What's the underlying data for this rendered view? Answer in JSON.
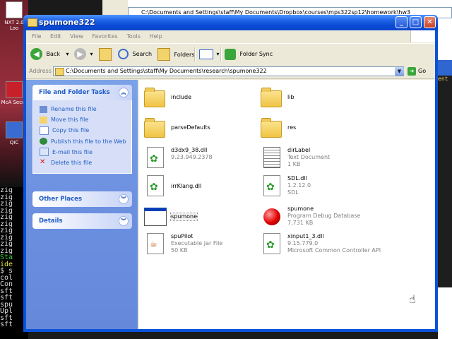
{
  "desktop": {
    "icons": [
      {
        "label": "NXT 2.0 Loo"
      },
      {
        "label": "McA Secur"
      },
      {
        "label": "QIC"
      }
    ],
    "terminal_lines": [
      {
        "text": "zig",
        "color": "plain"
      },
      {
        "text": "zig",
        "color": "plain"
      },
      {
        "text": "zig",
        "color": "plain"
      },
      {
        "text": "zig",
        "color": "plain"
      },
      {
        "text": "zig",
        "color": "plain"
      },
      {
        "text": "zig",
        "color": "plain"
      },
      {
        "text": "zig",
        "color": "plain"
      },
      {
        "text": "zig",
        "color": "plain"
      },
      {
        "text": "zig",
        "color": "plain"
      },
      {
        "text": "zig",
        "color": "plain"
      },
      {
        "text": "Sta",
        "color": "green"
      },
      {
        "text": "ide",
        "color": "yellow"
      },
      {
        "text": "$ s",
        "color": "plain"
      },
      {
        "text": "col",
        "color": "plain"
      },
      {
        "text": "Con",
        "color": "plain"
      },
      {
        "text": "sft",
        "color": "plain"
      },
      {
        "text": "sft",
        "color": "plain"
      },
      {
        "text": "spu",
        "color": "plain"
      },
      {
        "text": "Upl",
        "color": "plain"
      },
      {
        "text": "sft",
        "color": "plain"
      },
      {
        "text": "sft",
        "color": "plain"
      }
    ],
    "background_address": "C:\\Documents and Settings\\staff\\My Documents\\Dropbox\\courses\\mps322sp12\\homework\\hw3",
    "right_terminal_text": "ent"
  },
  "window": {
    "title": "spumone322",
    "buttons": {
      "minimize": "_",
      "maximize": "□",
      "close": "✕"
    }
  },
  "menu": [
    "File",
    "Edit",
    "View",
    "Favorites",
    "Tools",
    "Help"
  ],
  "toolbar": {
    "back": "Back",
    "search": "Search",
    "folders": "Folders",
    "folder_sync": "Folder Sync"
  },
  "addressbar": {
    "label": "Address",
    "value": "C:\\Documents and Settings\\staff\\My Documents\\research\\spumone322",
    "go": "Go"
  },
  "left_pane": {
    "tasks_header": "File and Folder Tasks",
    "tasks": [
      {
        "label": "Rename this file",
        "icon": "rename-icon"
      },
      {
        "label": "Move this file",
        "icon": "move-icon"
      },
      {
        "label": "Copy this file",
        "icon": "copy-icon"
      },
      {
        "label": "Publish this file to the Web",
        "icon": "globe-icon"
      },
      {
        "label": "E-mail this file",
        "icon": "email-icon"
      },
      {
        "label": "Delete this file",
        "icon": "delete-icon"
      }
    ],
    "other_places": "Other Places",
    "details": "Details"
  },
  "files": [
    {
      "name": "include",
      "line2": "",
      "line3": "",
      "kind": "folder"
    },
    {
      "name": "lib",
      "line2": "",
      "line3": "",
      "kind": "folder"
    },
    {
      "name": "parseDefaults",
      "line2": "",
      "line3": "",
      "kind": "folder"
    },
    {
      "name": "res",
      "line2": "",
      "line3": "",
      "kind": "folder"
    },
    {
      "name": "d3dx9_38.dll",
      "line2": "9.23.949.2378",
      "line3": "",
      "kind": "dll"
    },
    {
      "name": "dirLabel",
      "line2": "Text Document",
      "line3": "1 KB",
      "kind": "doc"
    },
    {
      "name": "irrKlang.dll",
      "line2": "",
      "line3": "",
      "kind": "dll"
    },
    {
      "name": "SDL.dll",
      "line2": "1.2.12.0",
      "line3": "SDL",
      "kind": "dll"
    },
    {
      "name": "spumone",
      "line2": "",
      "line3": "",
      "kind": "exe"
    },
    {
      "name": "spumone",
      "line2": "Program Debug Database",
      "line3": "7,731 KB",
      "kind": "pdb"
    },
    {
      "name": "spuPilot",
      "line2": "Executable Jar File",
      "line3": "50 KB",
      "kind": "jar"
    },
    {
      "name": "xinput1_3.dll",
      "line2": "9.15.779.0",
      "line3": "Microsoft Common Controller API",
      "kind": "dll"
    }
  ]
}
